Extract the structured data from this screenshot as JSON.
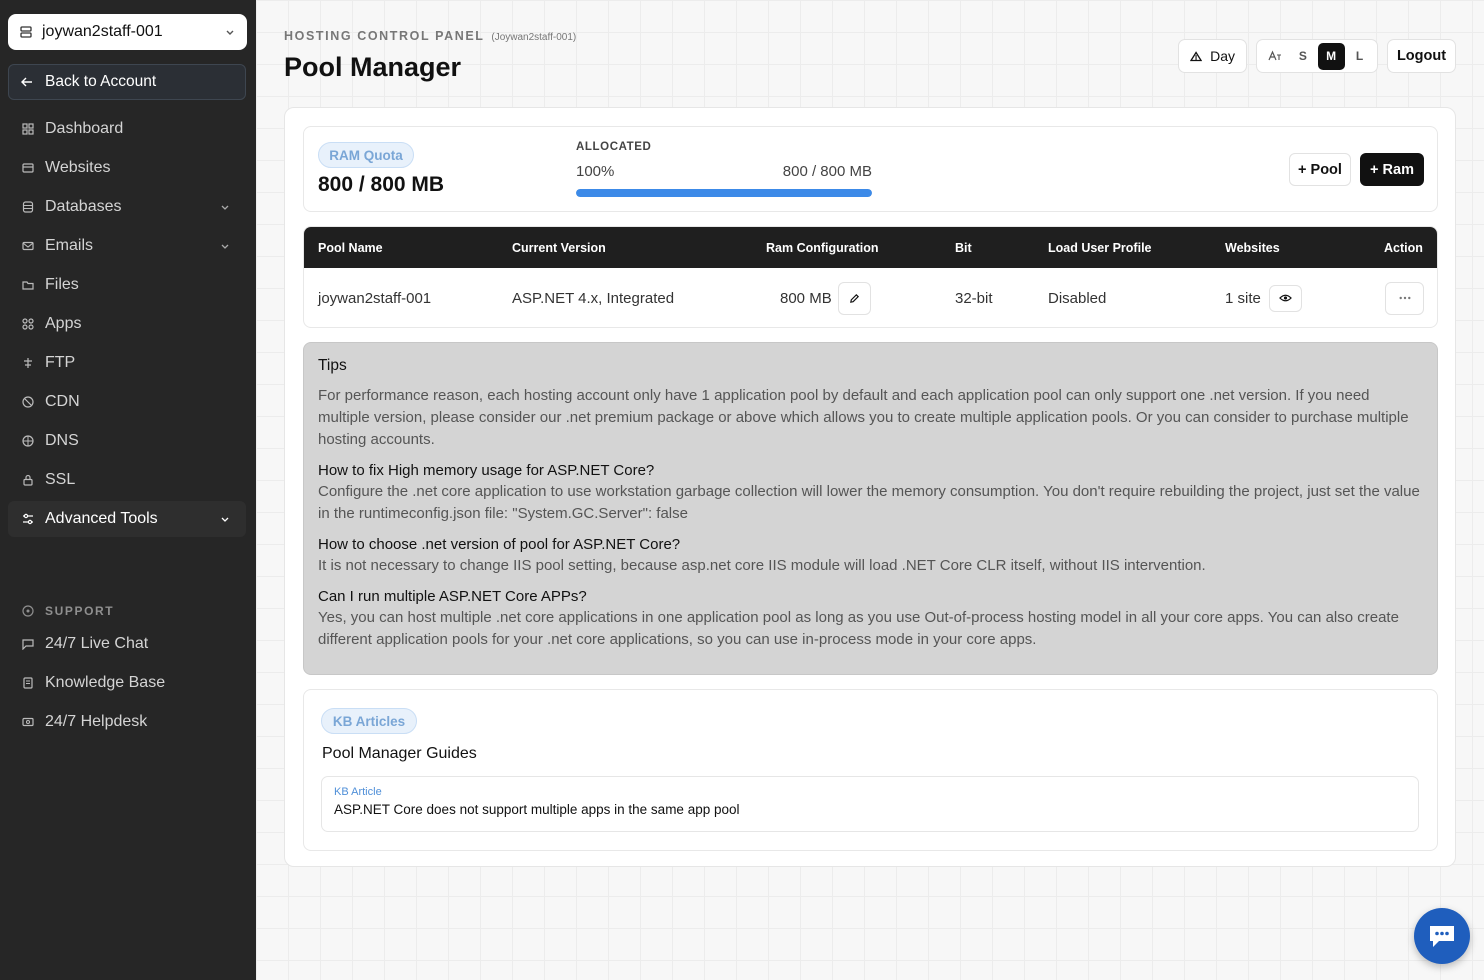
{
  "sidebar": {
    "account": "joywan2staff-001",
    "back": "Back to Account",
    "items": [
      {
        "label": "Dashboard",
        "icon": "grid-icon"
      },
      {
        "label": "Websites",
        "icon": "browser-icon"
      },
      {
        "label": "Databases",
        "icon": "database-icon"
      },
      {
        "label": "Emails",
        "icon": "mail-icon"
      },
      {
        "label": "Files",
        "icon": "folder-icon"
      },
      {
        "label": "Apps",
        "icon": "apps-icon"
      },
      {
        "label": "FTP",
        "icon": "transfer-icon"
      },
      {
        "label": "CDN",
        "icon": "globe-icon"
      },
      {
        "label": "DNS",
        "icon": "dns-icon"
      },
      {
        "label": "SSL",
        "icon": "lock-icon"
      },
      {
        "label": "Advanced Tools",
        "icon": "sliders-icon"
      }
    ],
    "support_header": "SUPPORT",
    "support_items": [
      {
        "label": "24/7 Live Chat",
        "icon": "chat-icon"
      },
      {
        "label": "Knowledge Base",
        "icon": "book-icon"
      },
      {
        "label": "24/7 Helpdesk",
        "icon": "ticket-icon"
      }
    ]
  },
  "header": {
    "eyebrow": "HOSTING CONTROL PANEL",
    "eyebrow_sub": "(Joywan2staff-001)",
    "title": "Pool Manager",
    "theme_label": "Day",
    "sizes": [
      "S",
      "M",
      "L"
    ],
    "selected_size": "M",
    "logout": "Logout"
  },
  "quota": {
    "badge": "RAM Quota",
    "value": "800 / 800 MB",
    "allocated_label": "ALLOCATED",
    "allocated_percent": "100%",
    "allocated_amount": "800 / 800 MB",
    "fill_fraction": 1.0,
    "add_pool": "+ Pool",
    "add_ram": "+ Ram"
  },
  "table": {
    "columns": [
      "Pool Name",
      "Current Version",
      "Ram Configuration",
      "Bit",
      "Load User Profile",
      "Websites",
      "Action"
    ],
    "rows": [
      {
        "pool_name": "joywan2staff-001",
        "version": "ASP.NET 4.x, Integrated",
        "ram": "800 MB",
        "bit": "32-bit",
        "load_user_profile": "Disabled",
        "websites": "1 site"
      }
    ]
  },
  "tips": {
    "title": "Tips",
    "intro": "For performance reason, each hosting account only have 1 application pool by default and each application pool can only support one .net version. If you need multiple version, please consider our .net premium package or above which allows you to create multiple application pools. Or you can consider to purchase multiple hosting accounts.",
    "faqs": [
      {
        "q": "How to fix High memory usage for ASP.NET Core?",
        "a": "Configure the .net core application to use workstation garbage collection will lower the memory consumption. You don't require rebuilding the project, just set the value in the runtimeconfig.json file: \"System.GC.Server\": false"
      },
      {
        "q": "How to choose .net version of pool for ASP.NET Core?",
        "a": "It is not necessary to change IIS pool setting, because asp.net core IIS module will load .NET Core CLR itself, without IIS intervention."
      },
      {
        "q": "Can I run multiple ASP.NET Core APPs?",
        "a": "Yes, you can host multiple .net core applications in one application pool as long as you use Out-of-process hosting model in all your core apps. You can also create different application pools for your .net core applications, so you can use in-process mode in your core apps."
      }
    ]
  },
  "kb": {
    "badge": "KB Articles",
    "title": "Pool Manager Guides",
    "articles": [
      {
        "type": "KB Article",
        "title": "ASP.NET Core does not support multiple apps in the same app pool"
      }
    ]
  },
  "colors": {
    "accent": "#3c8ae8",
    "sidebar_bg": "#262626",
    "chat_fab": "#1f5ebd"
  }
}
